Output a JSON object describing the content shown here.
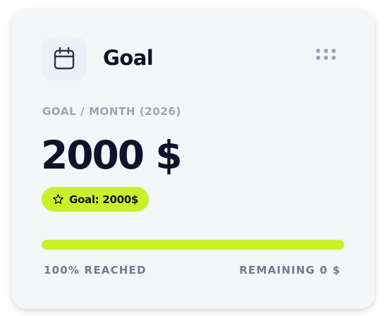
{
  "card": {
    "title": "Goal",
    "icon": "calendar-icon",
    "menu_icon": "dots-grid-icon"
  },
  "goal": {
    "label": "GOAL / MONTH (2026)",
    "amount": "2000 $",
    "badge_icon": "star-icon",
    "badge_text": "Goal: 2000$"
  },
  "progress": {
    "fraction": 1.0,
    "reached_label": "100% REACHED",
    "remaining_label": "REMAINING 0 $"
  },
  "colors": {
    "accent": "#c8f227",
    "title_text": "#10122c",
    "muted_label": "#9aa4b8",
    "footer_text": "#6f7b92",
    "card_background": "#f4f6f8"
  }
}
